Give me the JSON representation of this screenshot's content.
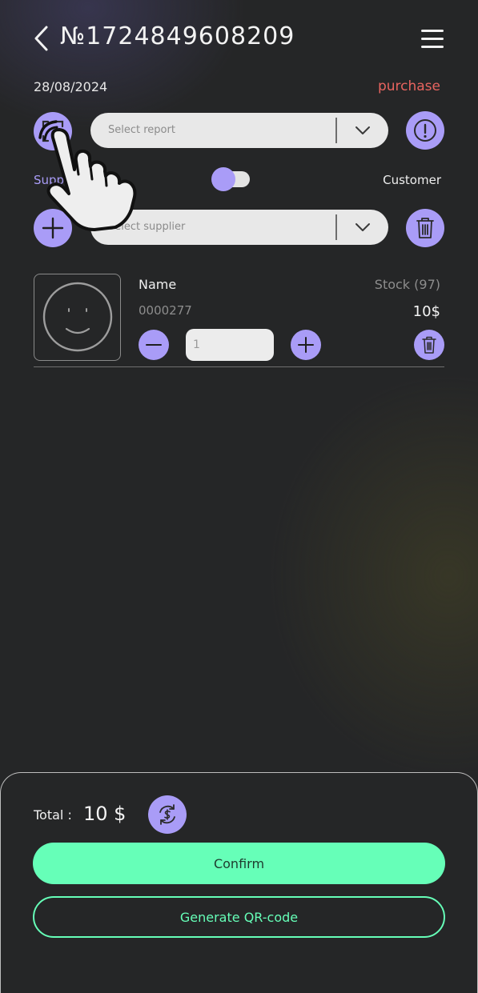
{
  "header": {
    "title": "№1724849608209",
    "date": "28/08/2024",
    "type_label": "purchase"
  },
  "report": {
    "placeholder": "Select report"
  },
  "party_toggle": {
    "left_label": "Supplier",
    "right_label": "Customer"
  },
  "supplier": {
    "placeholder": "Select supplier"
  },
  "product": {
    "name": "Name",
    "code": "0000277",
    "stock": "Stock (97)",
    "price": "10$",
    "quantity": "1"
  },
  "footer": {
    "total_label": "Total :",
    "total_value": "10 $",
    "confirm_label": "Confirm",
    "qr_label": "Generate QR-code"
  },
  "colors": {
    "accent": "#a99cf7",
    "primary_button": "#66ffb8",
    "type_label": "#e8645f",
    "background": "#252627"
  },
  "icons": [
    "chevron-left-icon",
    "menu-icon",
    "scan-icon",
    "chevron-down-icon",
    "info-icon",
    "plus-icon",
    "trash-icon",
    "minus-icon",
    "face-placeholder-icon",
    "currency-exchange-icon",
    "tap-hand-icon"
  ]
}
